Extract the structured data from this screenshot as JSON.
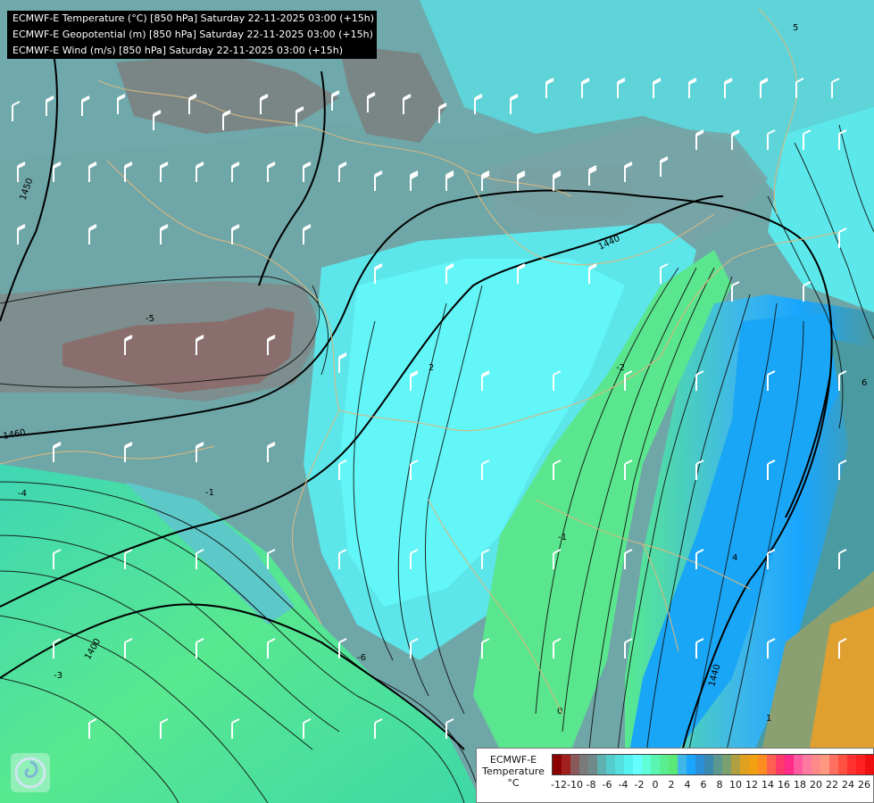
{
  "title_lines": [
    "ECMWF-E Temperature (°C) [850 hPa] Saturday 22-11-2025 03:00 (+15h)",
    "ECMWF-E Geopotential (m) [850 hPa] Saturday 22-11-2025 03:00 (+15h)",
    "ECMWF-E Wind (m/s) [850 hPa] Saturday 22-11-2025 03:00 (+15h)"
  ],
  "legend": {
    "model": "ECMWF-E",
    "variable": "Temperature",
    "unit": "°C",
    "tick_labels": [
      "-12",
      "-10",
      "-8",
      "-6",
      "-4",
      "-2",
      "0",
      "2",
      "4",
      "6",
      "8",
      "10",
      "12",
      "14",
      "16",
      "18",
      "20",
      "22",
      "24",
      "26"
    ],
    "colors": [
      "#8b0000",
      "#a02020",
      "#8a5a5a",
      "#7a7a7a",
      "#6e8a8a",
      "#5fb0b0",
      "#55cccc",
      "#55e0e0",
      "#55f2f2",
      "#66ffff",
      "#5fffd8",
      "#5af5b0",
      "#5aee90",
      "#5ae878",
      "#3fb8e8",
      "#1aa6ff",
      "#2b8fd8",
      "#3a8ab0",
      "#5a9890",
      "#7aa070",
      "#b0a040",
      "#e0a020",
      "#f0a010",
      "#ff8c20",
      "#ff6050",
      "#ff3a6a",
      "#ff2a8a",
      "#ff5aa0",
      "#ff7aa0",
      "#ff8a8a",
      "#ff9a80",
      "#ff7060",
      "#ff5040",
      "#ff3030",
      "#ff2020",
      "#ee1010"
    ]
  },
  "contour_labels": {
    "geopotential": [
      "1450",
      "1440",
      "1460",
      "1400",
      "1440"
    ],
    "temperature": [
      "-5",
      "-3",
      "-4",
      "-6",
      "-2",
      "-1",
      "0",
      "1",
      "2",
      "4",
      "6",
      "5",
      "-1"
    ]
  },
  "map_regions_color_ramp": {
    "darkest": "#8a6e6e",
    "dark_grey": "#7e8d8d",
    "slate": "#6fa6a6",
    "cyan": "#5ad6dc",
    "bright_cyan": "#60f4f6",
    "green": "#58e89a",
    "blue": "#20a8f0",
    "teal_east": "#4a9aa0",
    "olive": "#8aa070",
    "orange": "#e0a030"
  }
}
